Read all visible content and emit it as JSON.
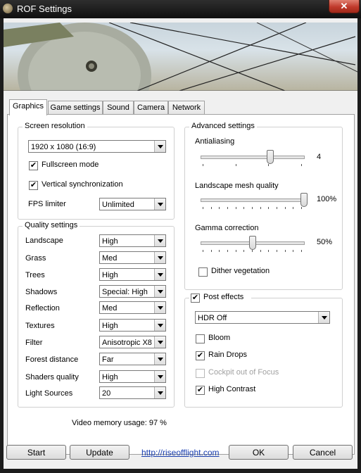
{
  "window": {
    "title": "ROF Settings",
    "close_glyph": "✕"
  },
  "tabs": [
    "Graphics",
    "Game settings",
    "Sound",
    "Camera",
    "Network"
  ],
  "screen_resolution": {
    "legend": "Screen resolution",
    "resolution": "1920 x 1080  (16:9)",
    "fullscreen": {
      "label": "Fullscreen mode",
      "checked": true
    },
    "vsync": {
      "label": "Vertical synchronization",
      "checked": true
    },
    "fps_limiter": {
      "label": "FPS limiter",
      "value": "Unlimited"
    }
  },
  "quality": {
    "legend": "Quality settings",
    "items": [
      {
        "label": "Landscape",
        "value": "High"
      },
      {
        "label": "Grass",
        "value": "Med"
      },
      {
        "label": "Trees",
        "value": "High"
      },
      {
        "label": "Shadows",
        "value": "Special: High"
      },
      {
        "label": "Reflection",
        "value": "Med"
      },
      {
        "label": "Textures",
        "value": "High"
      },
      {
        "label": "Filter",
        "value": "Anisotropic X8"
      },
      {
        "label": "Forest distance",
        "value": "Far"
      },
      {
        "label": "Shaders quality",
        "value": "High"
      },
      {
        "label": "Light Sources",
        "value": "20"
      }
    ]
  },
  "advanced": {
    "legend": "Advanced settings",
    "antialiasing": {
      "label": "Antialiasing",
      "value": "4",
      "level": 0.67
    },
    "mesh_quality": {
      "label": "Landscape mesh quality",
      "value": "100%",
      "level": 1.0
    },
    "gamma": {
      "label": "Gamma correction",
      "value": "50%",
      "level": 0.5
    },
    "dither": {
      "label": "Dither vegetation",
      "checked": false
    }
  },
  "post_effects": {
    "label": "Post effects",
    "checked": true,
    "hdr": "HDR Off",
    "bloom": {
      "label": "Bloom",
      "checked": false
    },
    "rain_drops": {
      "label": "Rain Drops",
      "checked": true
    },
    "cockpit_focus": {
      "label": "Cockpit out of Focus",
      "checked": false,
      "disabled": true
    },
    "high_contrast": {
      "label": "High Contrast",
      "checked": true
    }
  },
  "video_memory": "Video memory usage:   97 %",
  "buttons": {
    "start": "Start",
    "update": "Update",
    "link": "http://riseofflight.com",
    "ok": "OK",
    "cancel": "Cancel"
  },
  "colors": {
    "titlebar": "#1c1c1c",
    "close": "#c0392b",
    "link": "#1a3fb0"
  }
}
